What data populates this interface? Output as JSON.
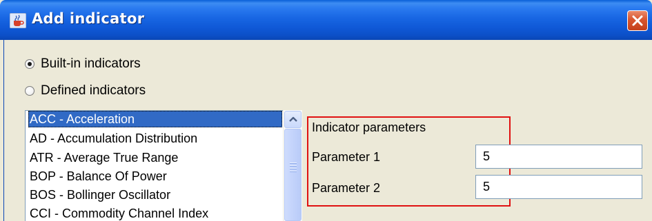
{
  "window": {
    "title": "Add indicator",
    "icon": "java-cup-icon",
    "close_icon": "close-icon"
  },
  "indicator_source": {
    "options": [
      {
        "label": "Built-in indicators",
        "checked": true
      },
      {
        "label": "Defined indicators",
        "checked": false
      }
    ]
  },
  "indicator_list": {
    "items": [
      {
        "label": "ACC - Acceleration",
        "selected": true
      },
      {
        "label": "AD - Accumulation Distribution",
        "selected": false
      },
      {
        "label": "ATR - Average True Range",
        "selected": false
      },
      {
        "label": "BOP - Balance Of Power",
        "selected": false
      },
      {
        "label": "BOS - Bollinger Oscillator",
        "selected": false
      },
      {
        "label": "CCI - Commodity Channel Index",
        "selected": false
      }
    ]
  },
  "parameters": {
    "heading": "Indicator parameters",
    "fields": [
      {
        "label": "Parameter 1",
        "value": "5"
      },
      {
        "label": "Parameter 2",
        "value": "5"
      }
    ]
  },
  "colors": {
    "titlebar": "#1866e3",
    "selection": "#316ac5",
    "highlight_border": "#e01010",
    "dialog_background": "#ece9d8"
  }
}
